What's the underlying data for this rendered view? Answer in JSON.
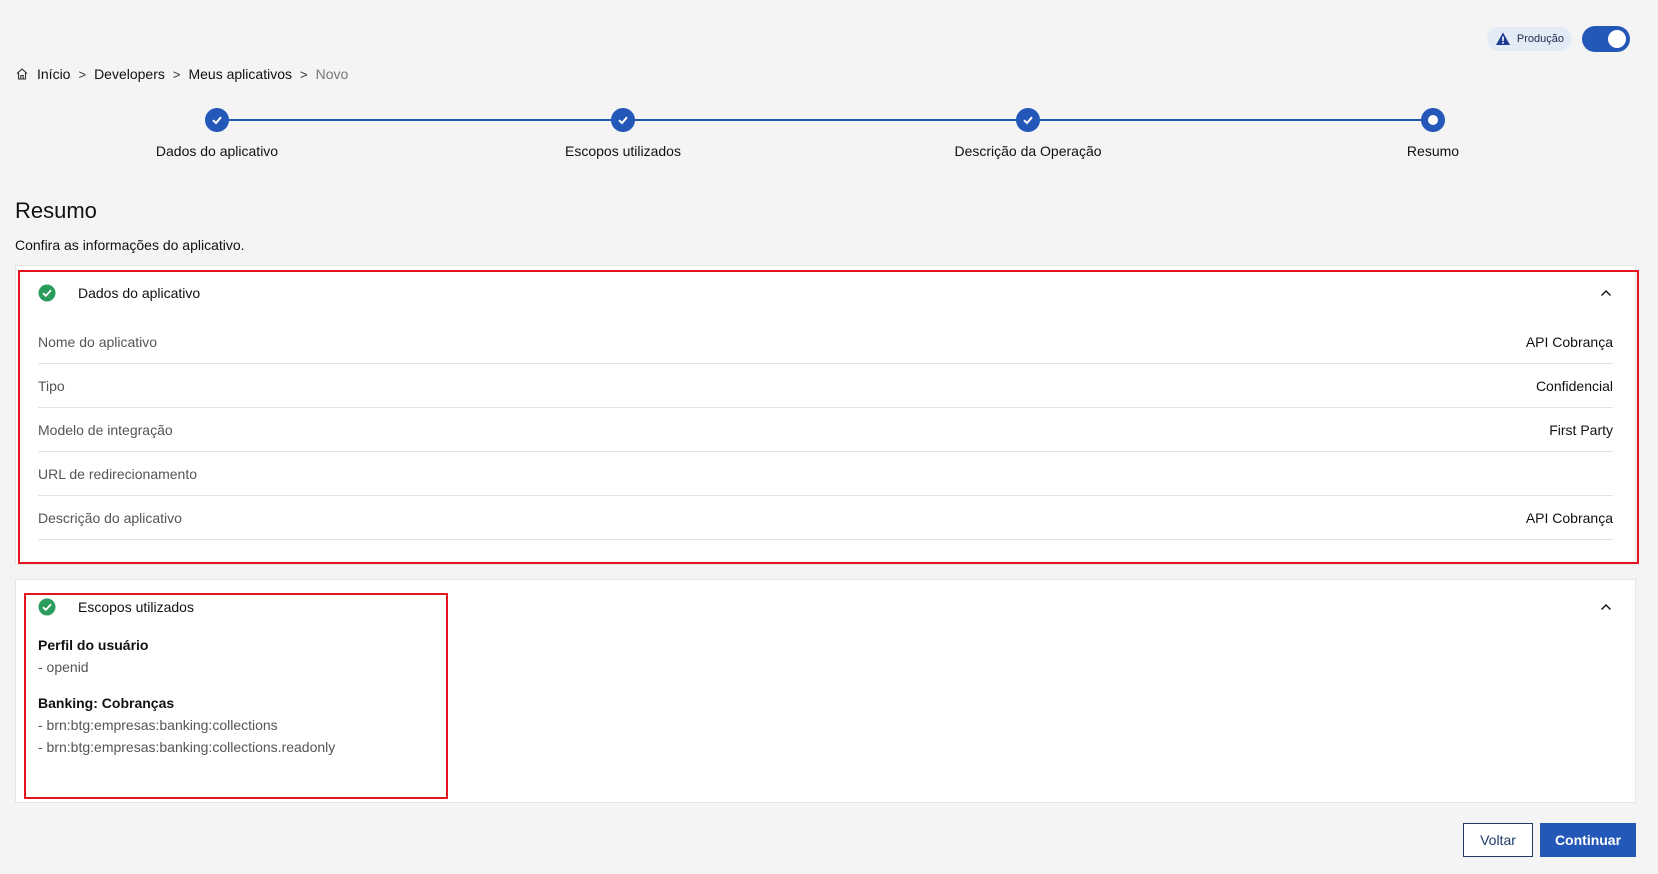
{
  "env": {
    "badge_label": "Produção",
    "badge_icon": "warning-icon",
    "toggle_on": true
  },
  "breadcrumb": {
    "home_icon": "home-icon",
    "items": [
      "Início",
      "Developers",
      "Meus aplicativos",
      "Novo"
    ],
    "separator": ">"
  },
  "stepper": {
    "steps": [
      {
        "label": "Dados do aplicativo",
        "state": "done"
      },
      {
        "label": "Escopos utilizados",
        "state": "done"
      },
      {
        "label": "Descrição da Operação",
        "state": "done"
      },
      {
        "label": "Resumo",
        "state": "current"
      }
    ]
  },
  "page": {
    "title": "Resumo",
    "subtitle": "Confira as informações do aplicativo."
  },
  "app_card": {
    "title": "Dados do aplicativo",
    "rows": [
      {
        "key": "Nome do aplicativo",
        "value": "API Cobrança"
      },
      {
        "key": "Tipo",
        "value": "Confidencial"
      },
      {
        "key": "Modelo de integração",
        "value": "First Party"
      },
      {
        "key": "URL de redirecionamento",
        "value": ""
      },
      {
        "key": "Descrição do aplicativo",
        "value": "API Cobrança"
      }
    ]
  },
  "scopes_card": {
    "title": "Escopos utilizados",
    "groups": [
      {
        "title": "Perfil do usuário",
        "items": [
          "- openid"
        ]
      },
      {
        "title": "Banking: Cobranças",
        "items": [
          "- brn:btg:empresas:banking:collections",
          "- brn:btg:empresas:banking:collections.readonly"
        ]
      }
    ]
  },
  "actions": {
    "back_label": "Voltar",
    "continue_label": "Continuar"
  },
  "colors": {
    "primary": "#2358b8",
    "success": "#2a9d5c",
    "highlight": "#e3161f"
  }
}
